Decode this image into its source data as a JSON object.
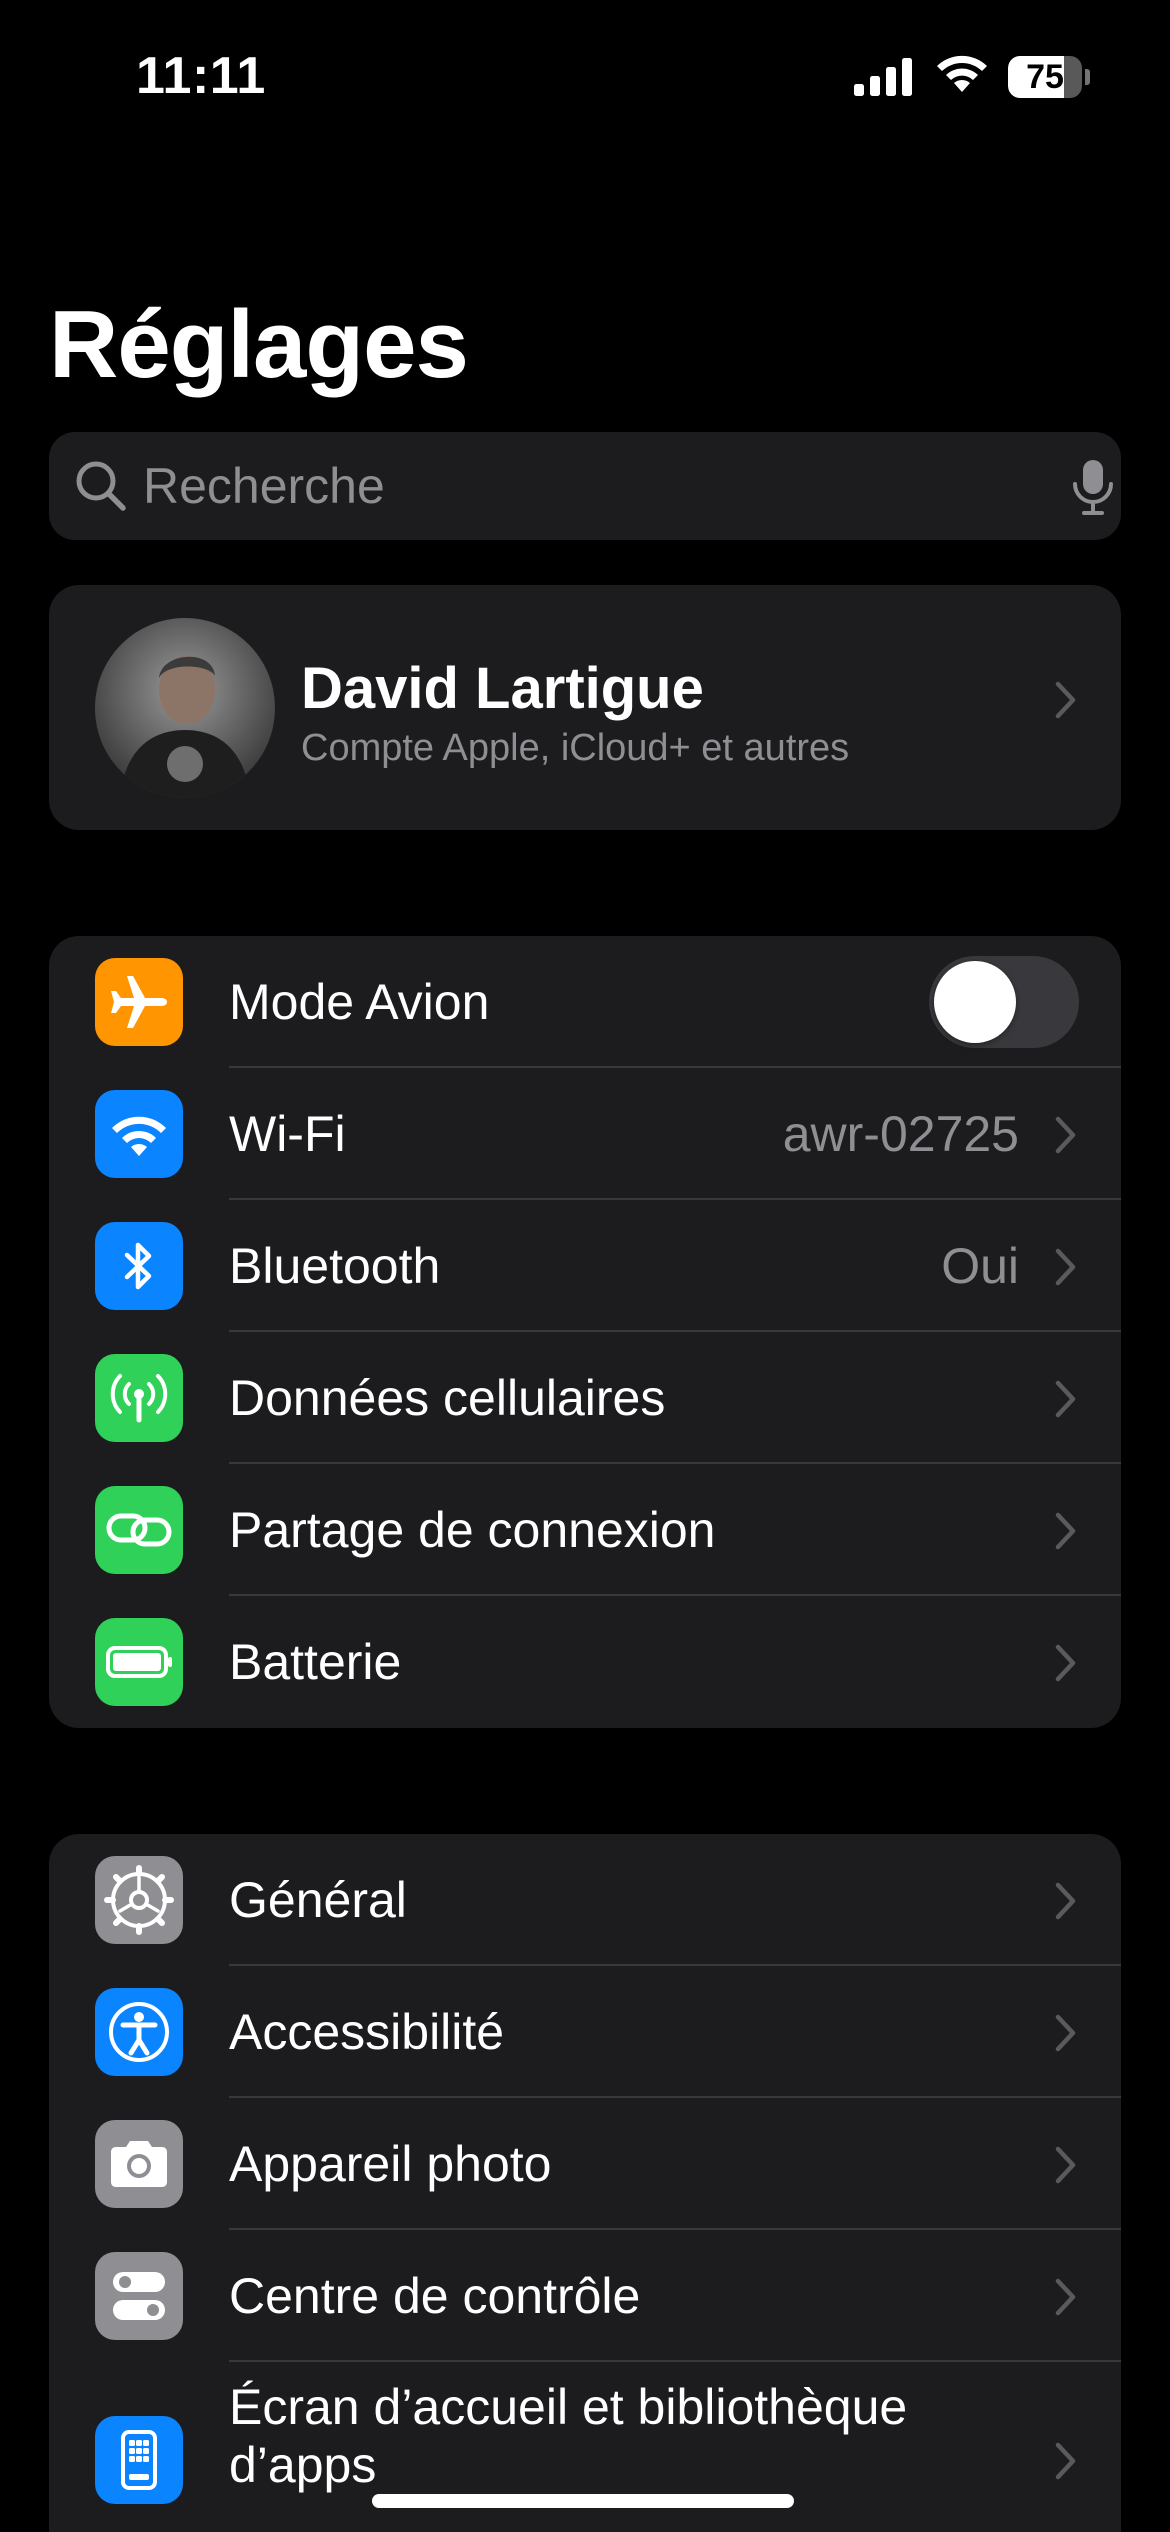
{
  "status_bar": {
    "time": "11:11",
    "battery_level": "75",
    "battery_fraction": 0.75
  },
  "page": {
    "title": "Réglages"
  },
  "search": {
    "placeholder": "Recherche",
    "icon": "magnifying-glass-icon",
    "mic_icon": "microphone-icon"
  },
  "profile": {
    "name": "David Lartigue",
    "subtitle": "Compte Apple, iCloud+ et autres"
  },
  "connectivity": {
    "items": [
      {
        "label": "Mode Avion",
        "icon": "airplane-icon",
        "color": "#ff9500",
        "toggle_on": false
      },
      {
        "label": "Wi-Fi",
        "icon": "wifi-icon",
        "color": "#0a84ff",
        "value": "awr-02725"
      },
      {
        "label": "Bluetooth",
        "icon": "bluetooth-icon",
        "color": "#0a84ff",
        "value": "Oui"
      },
      {
        "label": "Données cellulaires",
        "icon": "antenna-icon",
        "color": "#30d158"
      },
      {
        "label": "Partage de connexion",
        "icon": "link-icon",
        "color": "#30d158"
      },
      {
        "label": "Batterie",
        "icon": "battery-icon",
        "color": "#30d158"
      }
    ]
  },
  "system": {
    "items": [
      {
        "label": "Général",
        "icon": "gear-icon",
        "color": "#8e8e93"
      },
      {
        "label": "Accessibilité",
        "icon": "accessibility-icon",
        "color": "#0a84ff"
      },
      {
        "label": "Appareil photo",
        "icon": "camera-icon",
        "color": "#8e8e93"
      },
      {
        "label": "Centre de contrôle",
        "icon": "switches-icon",
        "color": "#8e8e93"
      },
      {
        "label": "Écran d’accueil et bibliothèque d’apps",
        "icon": "home-screen-icon",
        "color": "#0a84ff"
      }
    ]
  }
}
